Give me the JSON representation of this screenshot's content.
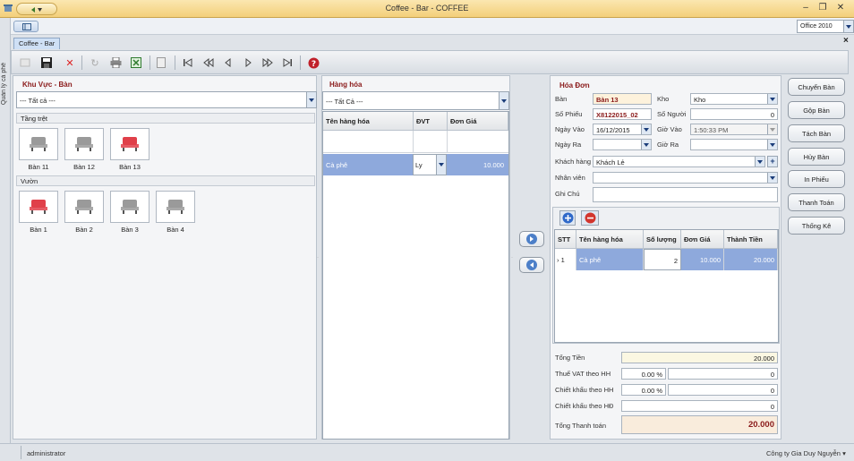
{
  "window": {
    "title": "Coffee - Bar - COFFEE"
  },
  "theme": {
    "label": "Office 2010"
  },
  "left_strip": {
    "label": "Quản lý cà phê"
  },
  "doc_tab": {
    "label": "Coffee - Bar"
  },
  "area_panel": {
    "title": "Khu Vực - Bàn",
    "filter_value": "--- Tất cả ---",
    "groups": [
      {
        "name": "Tầng trệt",
        "tables": [
          {
            "label": "Bàn 11",
            "occupied": false
          },
          {
            "label": "Bàn 12",
            "occupied": false
          },
          {
            "label": "Bàn 13",
            "occupied": true
          }
        ]
      },
      {
        "name": "Vườn",
        "tables": [
          {
            "label": "Bàn 1",
            "occupied": true
          },
          {
            "label": "Bàn 2",
            "occupied": false
          },
          {
            "label": "Bàn 3",
            "occupied": false
          },
          {
            "label": "Bàn 4",
            "occupied": false
          }
        ]
      }
    ]
  },
  "goods_panel": {
    "title": "Hàng hóa",
    "filter_value": "--- Tất Cả ---",
    "columns": [
      "Tên hàng hóa",
      "ĐVT",
      "Đơn Giá"
    ],
    "rows": [
      {
        "name": "Cà phê",
        "unit": "Ly",
        "price": "10.000"
      }
    ]
  },
  "invoice": {
    "title": "Hóa Đơn",
    "labels": {
      "ban": "Bàn",
      "kho": "Kho",
      "so_phieu": "Số Phiếu",
      "so_nguoi": "Số Người",
      "ngay_vao": "Ngày Vào",
      "gio_vao": "Giờ Vào",
      "ngay_ra": "Ngày Ra",
      "gio_ra": "Giờ Ra",
      "khach_hang": "Khách hàng",
      "nhan_vien": "Nhân viên",
      "ghi_chu": "Ghi Chú"
    },
    "values": {
      "ban": "Bàn 13",
      "kho": "Kho",
      "so_phieu": "X8122015_02",
      "so_nguoi": "0",
      "ngay_vao": "16/12/2015",
      "gio_vao": "1:50:33 PM",
      "ngay_ra": "",
      "gio_ra": "",
      "khach_hang": "Khách Lẻ",
      "nhan_vien": "",
      "ghi_chu": ""
    },
    "columns": [
      "STT",
      "Tên hàng hóa",
      "Số lượng",
      "Đơn Giá",
      "Thành Tiền"
    ],
    "rows": [
      {
        "stt": "1",
        "name": "Cà phê",
        "qty": "2",
        "price": "10.000",
        "total": "20.000"
      }
    ],
    "summary": {
      "tong_tien_label": "Tổng Tiền",
      "tong_tien": "20.000",
      "vat_label": "Thuế VAT theo HH",
      "vat_pct": "0.00 %",
      "vat_amount": "0",
      "ck_hh_label": "Chiết khấu theo HH",
      "ck_hh_pct": "0.00 %",
      "ck_hh_amount": "0",
      "ck_hd_label": "Chiết khấu theo HĐ",
      "ck_hd_amount": "0",
      "tong_tt_label": "Tổng Thanh toán",
      "tong_tt": "20.000"
    }
  },
  "actions": [
    "Chuyển Bàn",
    "Gộp Bàn",
    "Tách Bàn",
    "Hủy Bàn",
    "In Phiếu",
    "Thanh Toán",
    "Thống Kê"
  ],
  "status": {
    "user": "administrator",
    "company": "Công ty Gia Duy Nguyễn"
  },
  "colors": {
    "accent_title": "#8a1a1a",
    "selection": "#8ea9dc",
    "occupied": "#e0404a",
    "free": "#9a9a9a"
  }
}
